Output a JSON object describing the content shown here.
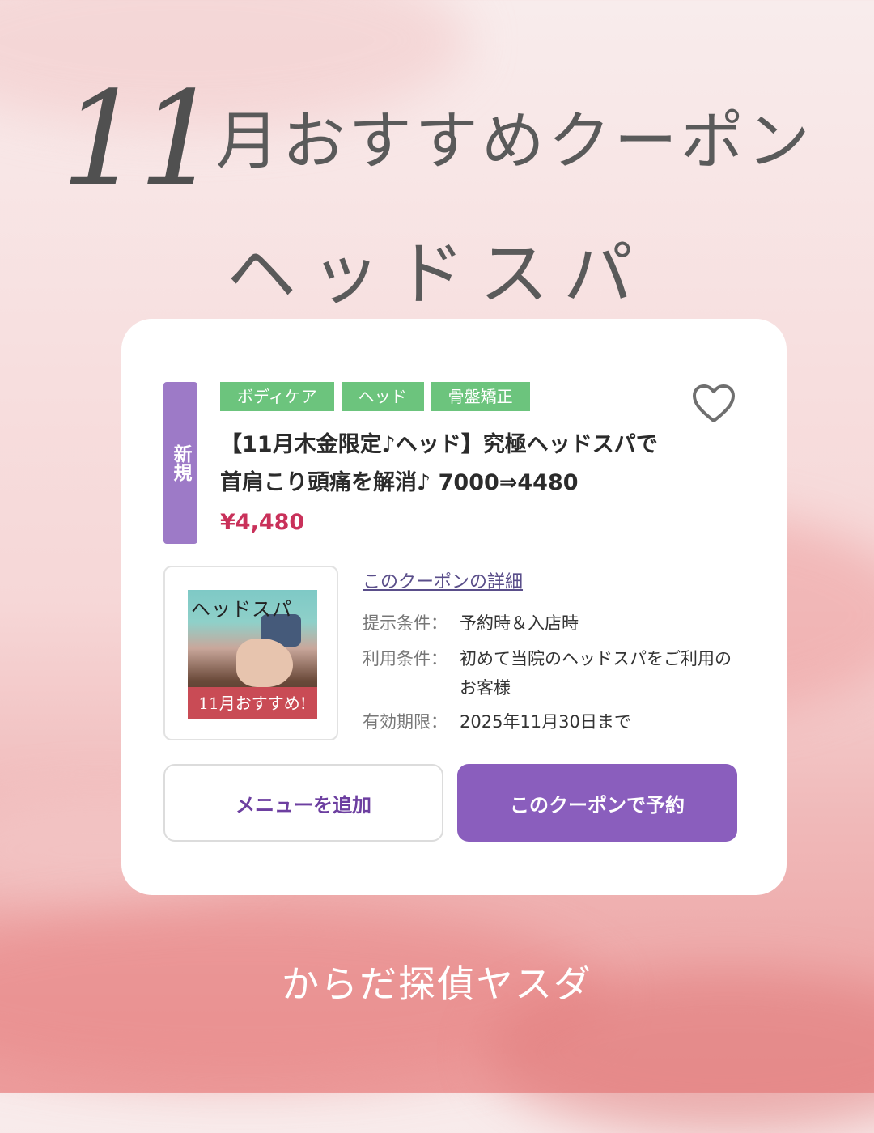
{
  "header": {
    "title_number": "11",
    "title_rest": "月おすすめクーポン",
    "subtitle": "ヘッドスパ"
  },
  "coupon": {
    "new_badge": "新規",
    "tags": [
      "ボディケア",
      "ヘッド",
      "骨盤矯正"
    ],
    "title": "【11月木金限定♪ヘッド】究極ヘッドスパで首肩こり頭痛を解消♪ 7000⇒4480",
    "price": "¥4,480",
    "thumbnail": {
      "top_text": "ヘッドスパ",
      "bottom_text": "11月おすすめ!"
    },
    "details_link": "このクーポンの詳細",
    "conditions": [
      {
        "label": "提示条件：",
        "value": "予約時＆入店時"
      },
      {
        "label": "利用条件：",
        "value": "初めて当院のヘッドスパをご利用のお客様"
      },
      {
        "label": "有効期限：",
        "value": "2025年11月30日まで"
      }
    ],
    "buttons": {
      "add_menu": "メニューを追加",
      "book": "このクーポンで予約"
    }
  },
  "footer": {
    "text": "からだ探偵ヤスダ"
  },
  "colors": {
    "tag": "#6cc47d",
    "badge": "#9d7ac7",
    "price": "#c9315a",
    "book_button": "#8a5ebd",
    "add_button_text": "#6d3fa0"
  },
  "icons": {
    "favorite": "heart-outline-icon"
  }
}
